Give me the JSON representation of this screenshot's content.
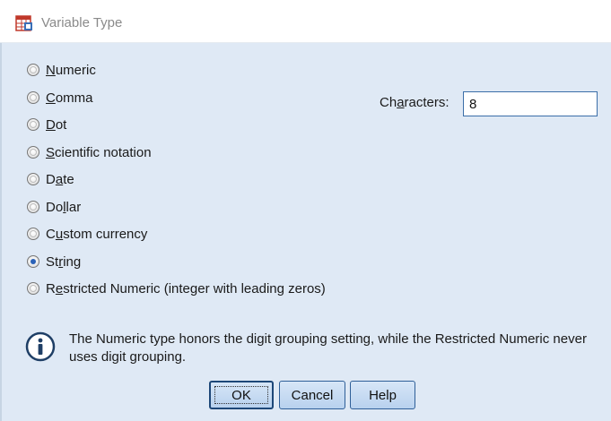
{
  "window": {
    "title": "Variable Type"
  },
  "type_options": [
    {
      "prefix": "",
      "mnemonic": "N",
      "rest": "umeric",
      "checked": false
    },
    {
      "prefix": "",
      "mnemonic": "C",
      "rest": "omma",
      "checked": false
    },
    {
      "prefix": "",
      "mnemonic": "D",
      "rest": "ot",
      "checked": false
    },
    {
      "prefix": "",
      "mnemonic": "S",
      "rest": "cientific notation",
      "checked": false
    },
    {
      "prefix": "D",
      "mnemonic": "a",
      "rest": "te",
      "checked": false
    },
    {
      "prefix": "Do",
      "mnemonic": "l",
      "rest": "lar",
      "checked": false
    },
    {
      "prefix": "C",
      "mnemonic": "u",
      "rest": "stom currency",
      "checked": false
    },
    {
      "prefix": "St",
      "mnemonic": "r",
      "rest": "ing",
      "checked": true
    },
    {
      "prefix": "R",
      "mnemonic": "e",
      "rest": "stricted Numeric (integer with leading zeros)",
      "checked": false
    }
  ],
  "characters": {
    "label_prefix": "Ch",
    "label_mnemonic": "a",
    "label_rest": "racters:",
    "value": "8"
  },
  "info": {
    "icon": "info-icon",
    "text": "The Numeric type honors the digit grouping setting, while the Restricted Numeric never uses digit grouping."
  },
  "buttons": {
    "ok_label": "OK",
    "cancel_label": "Cancel",
    "help_label": "Help"
  }
}
